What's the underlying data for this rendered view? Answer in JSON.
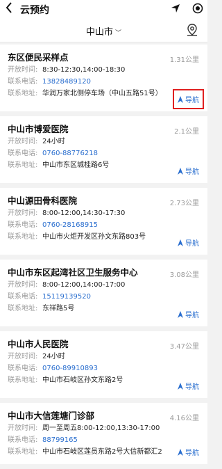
{
  "header": {
    "title": "云预约"
  },
  "city": {
    "name": "中山市"
  },
  "labels": {
    "hours": "开放时间:",
    "phone": "联系电话:",
    "address": "联系地址:",
    "nav": "导航"
  },
  "sites": [
    {
      "name": "东区便民采样点",
      "distance": "1.31公里",
      "hours": "8:30-12:30,14:00-18:30",
      "phone": "13828489120",
      "address": "华润万家北侧停车场（中山五路51号）"
    },
    {
      "name": "中山市博爱医院",
      "distance": "2.1公里",
      "hours": "24小时",
      "phone": "0760-88776218",
      "address": "中山市东区城桂路6号"
    },
    {
      "name": "中山源田骨科医院",
      "distance": "2.73公里",
      "hours": "8:00-12:00,14:30-17:30",
      "phone": "0760-28168915",
      "address": "中山市火炬开发区孙文东路803号"
    },
    {
      "name": "中山市东区起湾社区卫生服务中心",
      "distance": "3.08公里",
      "hours": "8:00-12:00,14:00-17:00",
      "phone": "15119139520",
      "address": "东祥路5号"
    },
    {
      "name": "中山市人民医院",
      "distance": "3.47公里",
      "hours": "24小时",
      "phone": "0760-89910893",
      "address": "中山市石岐区孙文东路2号"
    },
    {
      "name": "中山市大信莲塘门诊部",
      "distance": "4.16公里",
      "hours": "周一至周五8:00-12:00,13:30-17:00",
      "phone": "88799165",
      "address": "中山市石岐区莲员东路2号大信新都汇2"
    }
  ]
}
